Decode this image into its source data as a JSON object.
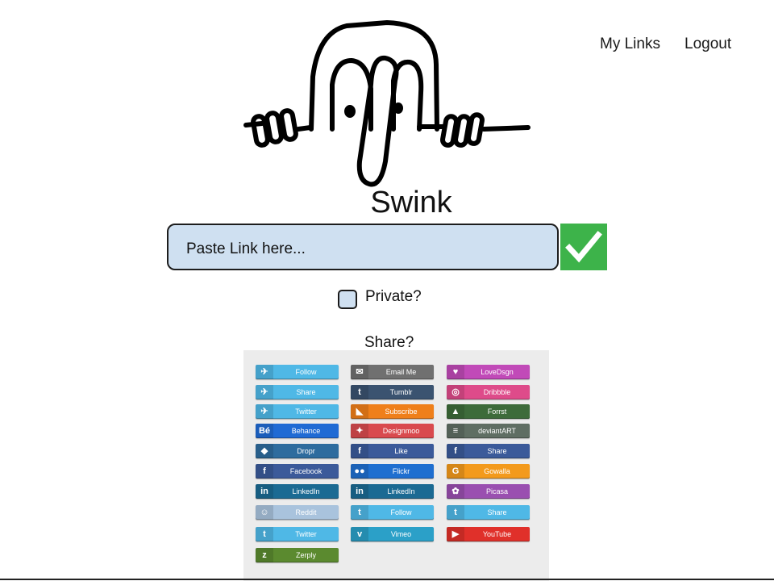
{
  "nav": {
    "my_links": "My Links",
    "logout": "Logout"
  },
  "brand": {
    "name": "Swink"
  },
  "link_input": {
    "placeholder": "Paste Link here..."
  },
  "submit": {
    "icon": "checkmark-icon",
    "color": "#3db34a"
  },
  "private": {
    "label": "Private?"
  },
  "share": {
    "label": "Share?",
    "columns": [
      [
        {
          "label": "Follow",
          "icon": "twitter-bird-icon",
          "color": "#4fb8e6"
        },
        {
          "label": "Share",
          "icon": "twitter-bird-icon",
          "color": "#4fb8e6"
        },
        {
          "label": "Twitter",
          "icon": "twitter-bird-icon",
          "color": "#4fb8e6"
        },
        {
          "label": "Behance",
          "icon": "behance-icon",
          "color": "#1f6ad4"
        },
        {
          "label": "Dropr",
          "icon": "dropr-icon",
          "color": "#2e6c9e"
        },
        {
          "label": "Facebook",
          "icon": "facebook-icon",
          "color": "#3b5a9a"
        },
        {
          "label": "LinkedIn",
          "icon": "linkedin-icon",
          "color": "#1b6a93"
        },
        {
          "label": "Reddit",
          "icon": "reddit-icon",
          "color": "#a9c3dd"
        },
        {
          "label": "Twitter",
          "icon": "twitter-icon",
          "color": "#4fb8e6"
        },
        {
          "label": "Zerply",
          "icon": "zerply-icon",
          "color": "#5b8a2f"
        }
      ],
      [
        {
          "label": "Email Me",
          "icon": "email-icon",
          "color": "#707070"
        },
        {
          "label": "Tumblr",
          "icon": "tumblr-icon",
          "color": "#3b5370"
        },
        {
          "label": "Subscribe",
          "icon": "rss-icon",
          "color": "#ef7f1a"
        },
        {
          "label": "Designmoo",
          "icon": "designmoo-icon",
          "color": "#d94a4e"
        },
        {
          "label": "Like",
          "icon": "facebook-icon",
          "color": "#3b5a9a"
        },
        {
          "label": "Flickr",
          "icon": "flickr-icon",
          "color": "#1f6fd0"
        },
        {
          "label": "LinkedIn",
          "icon": "linkedin-icon",
          "color": "#1b6a93"
        },
        {
          "label": "Follow",
          "icon": "twitter-icon",
          "color": "#4fb8e6"
        },
        {
          "label": "Vimeo",
          "icon": "vimeo-icon",
          "color": "#2ba0c8"
        }
      ],
      [
        {
          "label": "LoveDsgn",
          "icon": "heart-icon",
          "color": "#c14ab8"
        },
        {
          "label": "Dribbble",
          "icon": "dribbble-icon",
          "color": "#de4b8a"
        },
        {
          "label": "Forrst",
          "icon": "forrst-icon",
          "color": "#3d6b3a"
        },
        {
          "label": "deviantART",
          "icon": "deviantart-icon",
          "color": "#5f6e63"
        },
        {
          "label": "Share",
          "icon": "facebook-icon",
          "color": "#3b5a9a"
        },
        {
          "label": "Gowalla",
          "icon": "gowalla-icon",
          "color": "#f39a1c"
        },
        {
          "label": "Picasa",
          "icon": "picasa-icon",
          "color": "#9a4fb0"
        },
        {
          "label": "Share",
          "icon": "twitter-icon",
          "color": "#4fb8e6"
        },
        {
          "label": "YouTube",
          "icon": "youtube-icon",
          "color": "#e0302a"
        }
      ]
    ]
  }
}
